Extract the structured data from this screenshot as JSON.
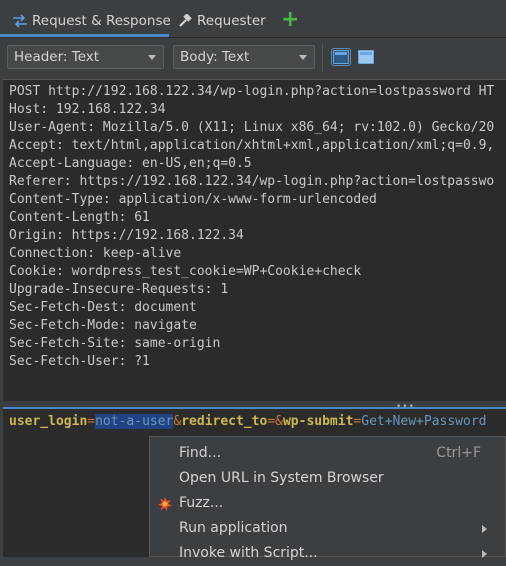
{
  "tabs": {
    "items": [
      {
        "label": "Request & Response"
      },
      {
        "label": "Requester"
      }
    ],
    "add_label": "+"
  },
  "toolbar": {
    "header_combo": "Header: Text",
    "body_combo": "Body: Text"
  },
  "request_headers": [
    "POST http://192.168.122.34/wp-login.php?action=lostpassword HT",
    "Host: 192.168.122.34",
    "User-Agent: Mozilla/5.0 (X11; Linux x86_64; rv:102.0) Gecko/20",
    "Accept: text/html,application/xhtml+xml,application/xml;q=0.9,",
    "Accept-Language: en-US,en;q=0.5",
    "Referer: https://192.168.122.34/wp-login.php?action=lostpasswo",
    "Content-Type: application/x-www-form-urlencoded",
    "Content-Length: 61",
    "Origin: https://192.168.122.34",
    "Connection: keep-alive",
    "Cookie: wordpress_test_cookie=WP+Cookie+check",
    "Upgrade-Insecure-Requests: 1",
    "Sec-Fetch-Dest: document",
    "Sec-Fetch-Mode: navigate",
    "Sec-Fetch-Site: same-origin",
    "Sec-Fetch-User: ?1"
  ],
  "body": {
    "k1": "user_login",
    "eq1": "=",
    "v1": "not-a-user",
    "amp1": "&",
    "k2": "redirect_to",
    "eq2": "=",
    "amp2": "&",
    "k3": "wp-submit",
    "eq3": "=",
    "v3": "Get+New+Password"
  },
  "context_menu": [
    {
      "label": "Find...",
      "shortcut": "Ctrl+F"
    },
    {
      "label": "Open URL in System Browser"
    },
    {
      "label": "Fuzz..."
    },
    {
      "label": "Run application"
    },
    {
      "label": "Invoke with Script..."
    }
  ],
  "colors": {
    "accent": "#4a88c7",
    "keyword": "#cdb84f",
    "value": "#6897bb",
    "selection": "#214283"
  }
}
